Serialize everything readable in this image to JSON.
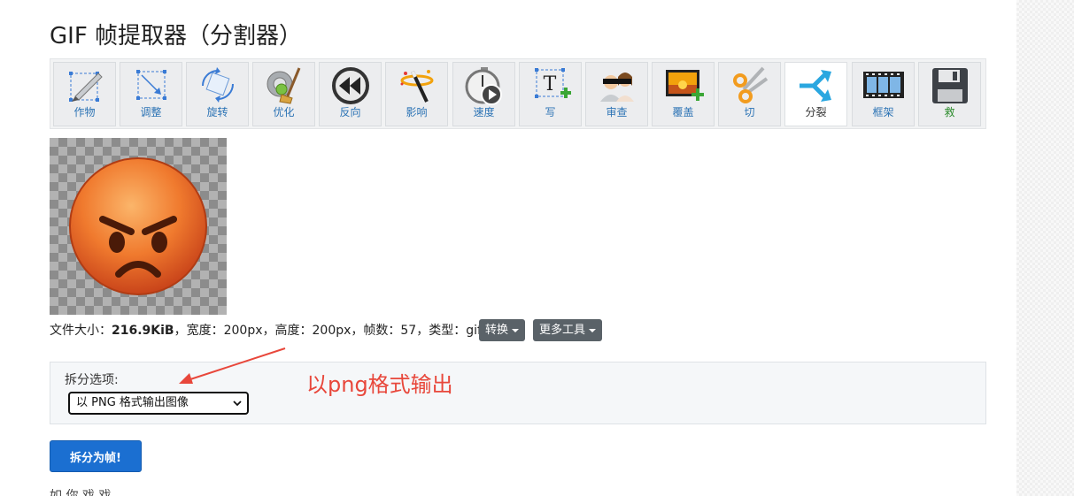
{
  "page": {
    "title": "GIF 帧提取器（分割器）"
  },
  "toolbar": {
    "tools": [
      {
        "label": "作物",
        "icon": "crop-icon"
      },
      {
        "label": "调整",
        "icon": "resize-icon"
      },
      {
        "label": "旋转",
        "icon": "rotate-icon"
      },
      {
        "label": "优化",
        "icon": "optimize-icon"
      },
      {
        "label": "反向",
        "icon": "reverse-icon"
      },
      {
        "label": "影响",
        "icon": "effects-icon"
      },
      {
        "label": "速度",
        "icon": "speed-icon"
      },
      {
        "label": "写",
        "icon": "write-text-icon"
      },
      {
        "label": "审查",
        "icon": "censor-icon"
      },
      {
        "label": "覆盖",
        "icon": "overlay-icon"
      },
      {
        "label": "切",
        "icon": "cut-icon"
      },
      {
        "label": "分裂",
        "icon": "split-icon",
        "active": true
      },
      {
        "label": "框架",
        "icon": "frames-icon"
      },
      {
        "label": "救",
        "icon": "save-icon"
      }
    ]
  },
  "preview": {
    "icon": "angry-face-emoji-icon"
  },
  "file_info": {
    "size_label": "文件大小：",
    "size_value": "216.9KiB",
    "rest": "，宽度：200px，高度：200px，帧数：57，类型：gif",
    "convert_button": "转换",
    "more_tools_button": "更多工具"
  },
  "split_options": {
    "label": "拆分选项:",
    "selected": "以 PNG 格式输出图像"
  },
  "annotation": {
    "text": "以png格式输出",
    "color": "#e8473b"
  },
  "submit_button": "拆分为帧!",
  "cutoff_text": "如  你  戏  戏",
  "colors": {
    "accent": "#1b6fd1",
    "link": "#2d74b5",
    "dark_button": "#5a6268"
  }
}
